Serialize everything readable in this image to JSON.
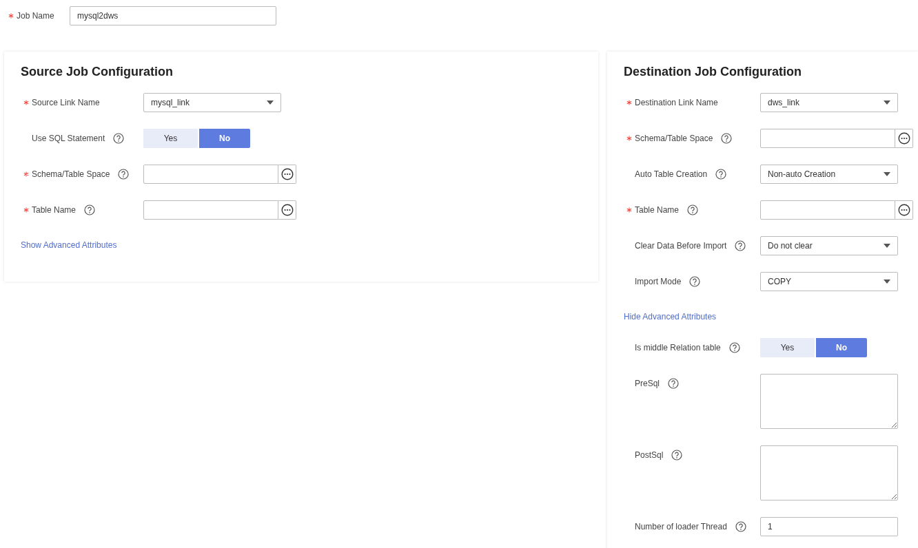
{
  "job_name": {
    "label": "Job Name",
    "required": true,
    "value": "mysql2dws"
  },
  "source": {
    "title": "Source Job Configuration",
    "fields": [
      {
        "kind": "select",
        "label": "Source Link Name",
        "required": true,
        "help": false,
        "value": "mysql_link"
      },
      {
        "kind": "toggle",
        "label": "Use SQL Statement",
        "required": false,
        "help": true,
        "options": [
          {
            "label": "Yes",
            "selected": false
          },
          {
            "label": "No",
            "selected": true
          }
        ]
      },
      {
        "kind": "picker",
        "label": "Schema/Table Space",
        "required": true,
        "help": true
      },
      {
        "kind": "picker",
        "label": "Table Name",
        "required": true,
        "help": true
      },
      {
        "kind": "link",
        "label": "Show Advanced Attributes"
      }
    ]
  },
  "destination": {
    "title": "Destination Job Configuration",
    "fields": [
      {
        "kind": "select",
        "label": "Destination Link Name",
        "required": true,
        "help": false,
        "value": "dws_link"
      },
      {
        "kind": "picker",
        "label": "Schema/Table Space",
        "required": true,
        "help": true
      },
      {
        "kind": "select",
        "label": "Auto Table Creation",
        "required": false,
        "help": true,
        "value": "Non-auto Creation"
      },
      {
        "kind": "picker",
        "label": "Table Name",
        "required": true,
        "help": true
      },
      {
        "kind": "select",
        "label": "Clear Data Before Import",
        "required": false,
        "help": true,
        "value": "Do not clear"
      },
      {
        "kind": "select",
        "label": "Import Mode",
        "required": false,
        "help": true,
        "value": "COPY"
      },
      {
        "kind": "link",
        "label": "Hide Advanced Attributes"
      },
      {
        "kind": "toggle",
        "label": "Is middle Relation table",
        "required": false,
        "help": true,
        "options": [
          {
            "label": "Yes",
            "selected": false
          },
          {
            "label": "No",
            "selected": true
          }
        ]
      },
      {
        "kind": "textarea",
        "label": "PreSql",
        "required": false,
        "help": true
      },
      {
        "kind": "textarea",
        "label": "PostSql",
        "required": false,
        "help": true
      },
      {
        "kind": "text",
        "label": "Number of loader Thread",
        "required": false,
        "help": true,
        "value": "1"
      }
    ]
  }
}
